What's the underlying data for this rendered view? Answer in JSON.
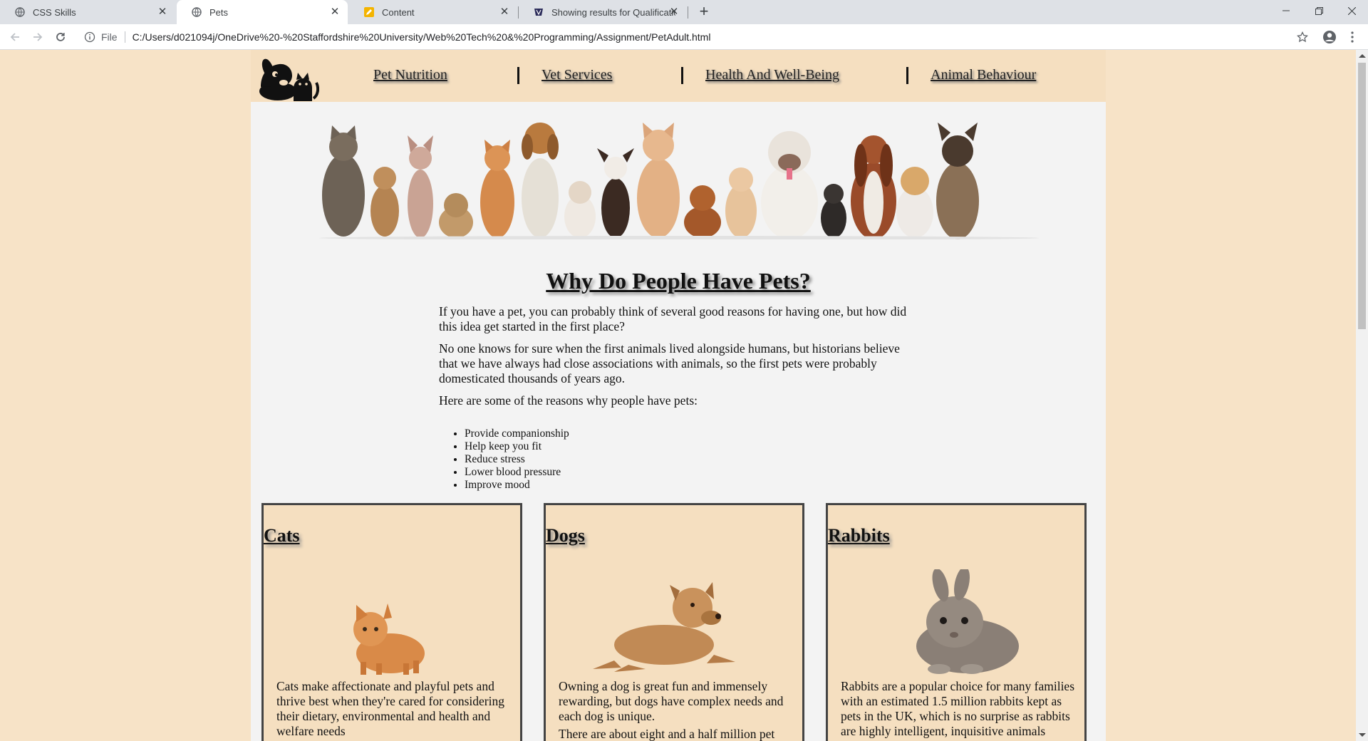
{
  "browser": {
    "tabs": [
      {
        "label": "CSS Skills",
        "icon": "globe-icon"
      },
      {
        "label": "Pets",
        "icon": "globe-icon"
      },
      {
        "label": "Content",
        "icon": "pencil-icon"
      },
      {
        "label": "Showing results for Qualification",
        "icon": "crest-icon"
      }
    ],
    "new_tab": "+",
    "address_scheme": "File",
    "address_url": "C:/Users/d021094j/OneDrive%20-%20Staffordshire%20University/Web%20Tech%20&%20Programming/Assignment/PetAdult.html"
  },
  "nav": {
    "links": [
      "Pet Nutrition",
      "Vet Services",
      "Health And Well-Being",
      "Animal Behaviour"
    ]
  },
  "main": {
    "heading": "Why Do People Have Pets?",
    "paragraphs": [
      "If you have a pet, you can probably think of several good reasons for having one, but how did this idea get started in the first place?",
      "No one knows for sure when the first animals lived alongside humans, but historians believe that we have always had close associations with animals, so the first pets were probably domesticated thousands of years ago.",
      "Here are some of the reasons why people have pets:"
    ],
    "reasons": [
      "Provide companionship",
      "Help keep you fit",
      "Reduce stress",
      "Lower blood pressure",
      "Improve mood"
    ]
  },
  "cards": [
    {
      "title": "Cats",
      "text": [
        "Cats make affectionate and playful pets and thrive best when they're cared for considering their dietary, environmental and health and welfare needs"
      ]
    },
    {
      "title": "Dogs",
      "text": [
        "Owning a dog is great fun and immensely rewarding, but dogs have complex needs and each dog is unique.",
        "There are about eight and a half million pet"
      ]
    },
    {
      "title": "Rabbits",
      "text": [
        "Rabbits are a popular choice for many families with an estimated 1.5 million rabbits kept as pets in the UK, which is no surprise as rabbits are highly intelligent, inquisitive animals"
      ]
    }
  ],
  "colors": {
    "page_background": "#f7e3c7",
    "content_background": "#f3f3f3",
    "nav_background": "#f5dfc0",
    "card_border": "#444444"
  }
}
